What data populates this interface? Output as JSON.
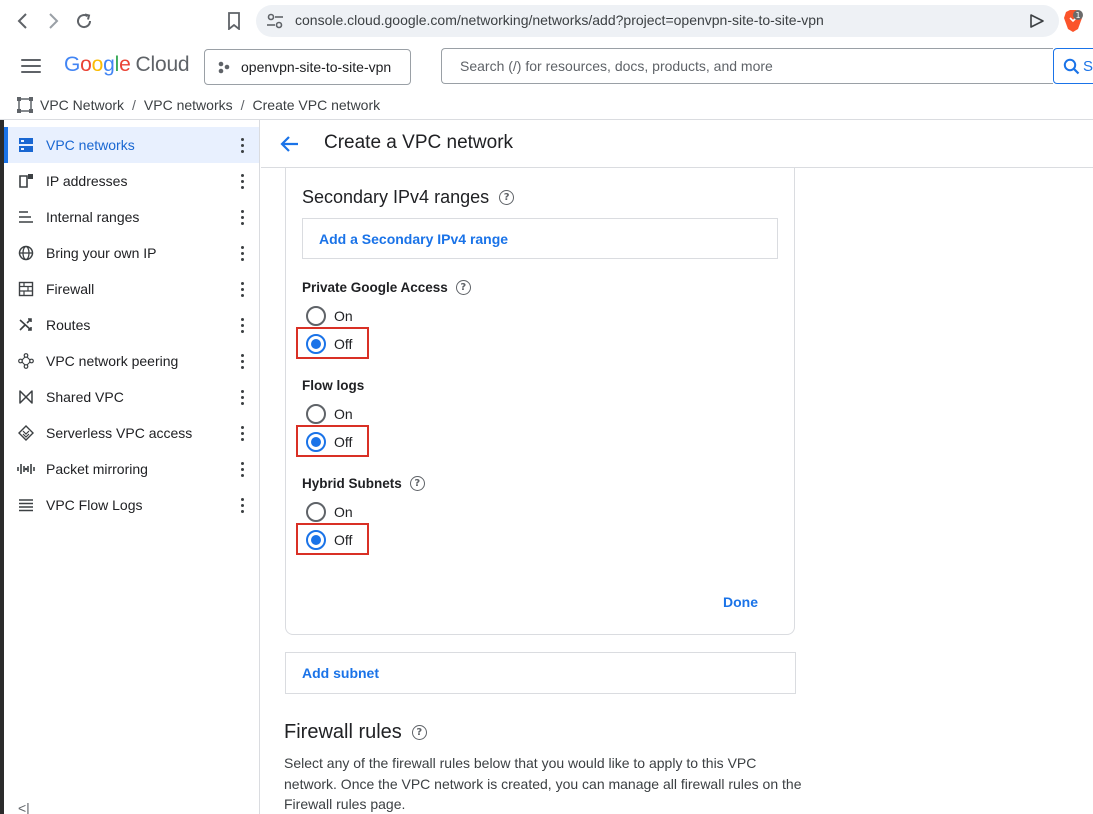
{
  "browser": {
    "url": "console.cloud.google.com/networking/networks/add?project=openvpn-site-to-site-vpn",
    "extension_badge": "1"
  },
  "header": {
    "logo_letters": [
      "G",
      "o",
      "o",
      "g",
      "l",
      "e"
    ],
    "logo_suffix": "Cloud",
    "project_name": "openvpn-site-to-site-vpn",
    "search_placeholder": "Search (/) for resources, docs, products, and more",
    "search_button_label": "S"
  },
  "breadcrumb": {
    "items": [
      "VPC Network",
      "VPC networks",
      "Create VPC network"
    ],
    "separator": "/"
  },
  "sidebar": {
    "items": [
      {
        "label": "VPC networks",
        "icon": "vpc-networks-icon",
        "active": true
      },
      {
        "label": "IP addresses",
        "icon": "ip-addresses-icon",
        "active": false
      },
      {
        "label": "Internal ranges",
        "icon": "internal-ranges-icon",
        "active": false
      },
      {
        "label": "Bring your own IP",
        "icon": "globe-icon",
        "active": false
      },
      {
        "label": "Firewall",
        "icon": "firewall-icon",
        "active": false
      },
      {
        "label": "Routes",
        "icon": "routes-icon",
        "active": false
      },
      {
        "label": "VPC network peering",
        "icon": "peering-icon",
        "active": false
      },
      {
        "label": "Shared VPC",
        "icon": "shared-vpc-icon",
        "active": false
      },
      {
        "label": "Serverless VPC access",
        "icon": "serverless-icon",
        "active": false
      },
      {
        "label": "Packet mirroring",
        "icon": "packet-mirroring-icon",
        "active": false
      },
      {
        "label": "VPC Flow Logs",
        "icon": "flow-logs-icon",
        "active": false
      }
    ],
    "collapse_label": "<|"
  },
  "main": {
    "page_title": "Create a VPC network",
    "secondary_ranges_title": "Secondary IPv4 ranges",
    "add_range_label": "Add a Secondary IPv4 range",
    "private_google_access": {
      "label": "Private Google Access",
      "on": "On",
      "off": "Off",
      "selected": "Off"
    },
    "flow_logs": {
      "label": "Flow logs",
      "on": "On",
      "off": "Off",
      "selected": "Off"
    },
    "hybrid_subnets": {
      "label": "Hybrid Subnets",
      "on": "On",
      "off": "Off",
      "selected": "Off"
    },
    "done_label": "Done",
    "add_subnet_label": "Add subnet",
    "firewall_title": "Firewall rules",
    "firewall_description": "Select any of the firewall rules below that you would like to apply to this VPC network. Once the VPC network is created, you can manage all firewall rules on the Firewall rules page."
  },
  "colors": {
    "accent": "#1a73e8",
    "highlight": "#d93025",
    "active_bg": "#e8f0fe"
  }
}
